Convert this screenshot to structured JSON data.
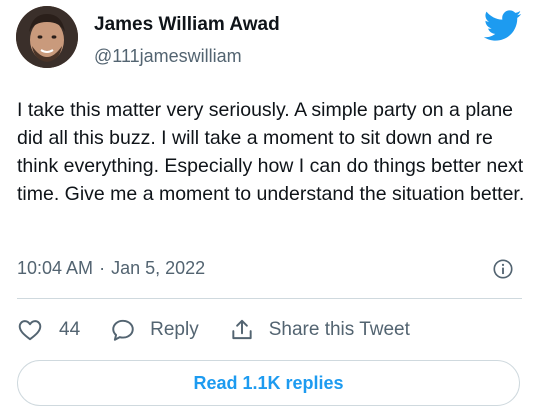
{
  "author": {
    "name": "James William Awad",
    "handle": "@111jameswilliam"
  },
  "tweet": {
    "text": "I take this matter very seriously. A simple party on a plane did all this buzz. I will take a moment to sit down and re think everything. Especially how I can do things better next time. Give me a moment to understand the situation better.",
    "time": "10:04 AM",
    "date": "Jan 5, 2022",
    "separator": "·"
  },
  "actions": {
    "like_count": "44",
    "reply_label": "Reply",
    "share_label": "Share this Tweet"
  },
  "footer": {
    "read_replies_label": "Read 1.1K replies"
  },
  "colors": {
    "brand": "#1d9bf0",
    "text": "#0f1419",
    "secondary": "#536471",
    "border": "#cfd9de"
  },
  "icons": [
    "avatar",
    "twitter-bird-icon",
    "info-icon",
    "heart-icon",
    "reply-icon",
    "share-icon"
  ]
}
